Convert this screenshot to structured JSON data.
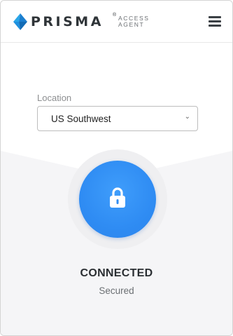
{
  "header": {
    "brand": "PRISMA",
    "registered_mark": "®",
    "product_line1": "ACCESS",
    "product_line2": "AGENT",
    "menu_icon": "hamburger-menu-icon"
  },
  "location": {
    "label": "Location",
    "selected": "US Southwest",
    "chevron": "⌄"
  },
  "status": {
    "icon": "lock-icon",
    "title": "CONNECTED",
    "subtitle": "Secured",
    "accent_color": "#2f8cf3"
  }
}
